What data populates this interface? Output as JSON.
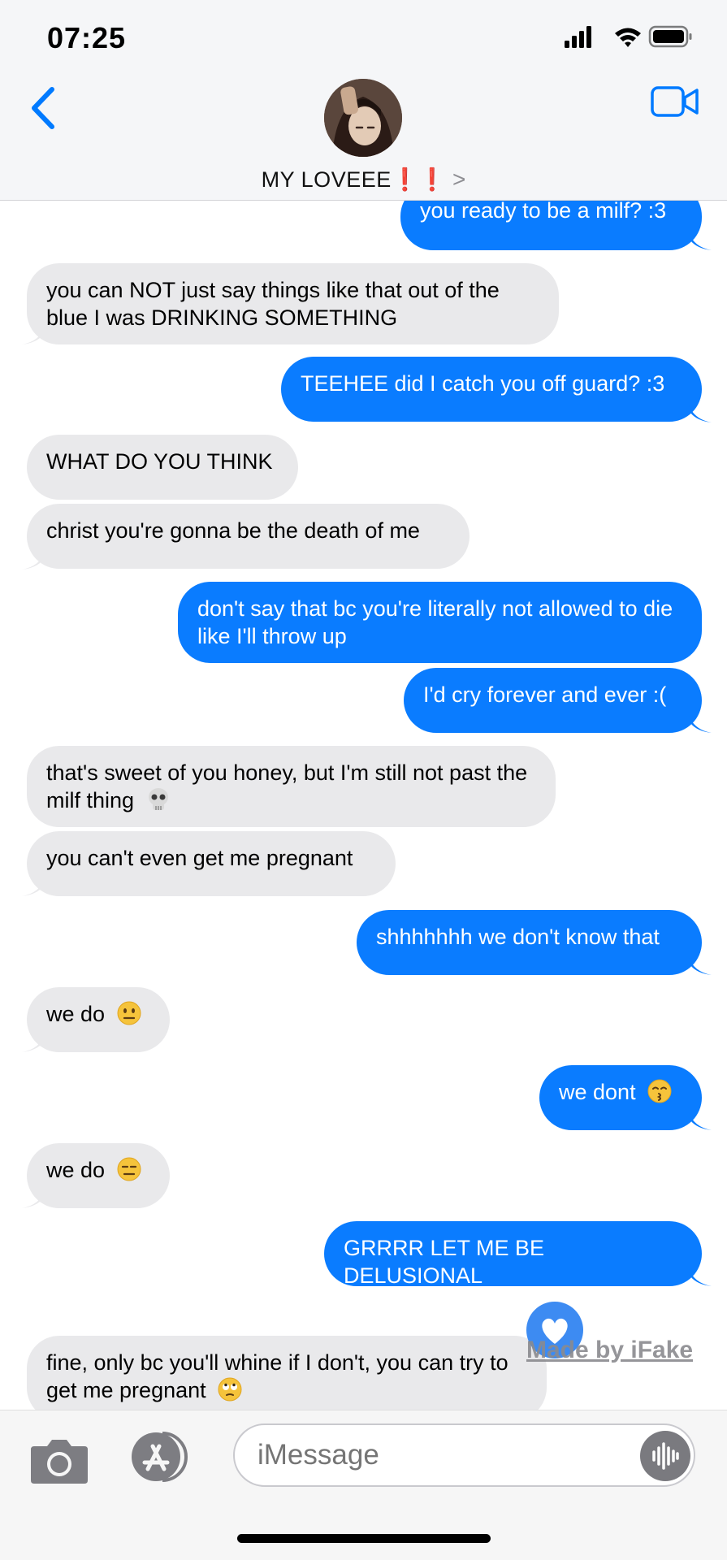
{
  "status_bar": {
    "time": "07:25"
  },
  "header": {
    "contact_name": "MY LOVEEE",
    "contact_emoji": "❗❗",
    "chevron": ">"
  },
  "messages": [
    {
      "side": "out",
      "text": "you ready to be a milf? :3"
    },
    {
      "side": "in",
      "text": "you can NOT just say things like that out of the blue I was DRINKING SOMETHING"
    },
    {
      "side": "out",
      "text": "TEEHEE did I catch you off guard? :3"
    },
    {
      "side": "in",
      "text": "WHAT DO YOU THINK"
    },
    {
      "side": "in",
      "text": "christ you're gonna be the death of me"
    },
    {
      "side": "out",
      "text": "don't say that bc you're literally not allowed to die like I'll throw up"
    },
    {
      "side": "out",
      "text": "I'd cry forever and ever :("
    },
    {
      "side": "in",
      "text": "that's sweet of you honey, but I'm still not past the milf thing",
      "emoji": "skull-emoji"
    },
    {
      "side": "in",
      "text": "you can't even get me pregnant"
    },
    {
      "side": "out",
      "text": "shhhhhhh we don't know that"
    },
    {
      "side": "in",
      "text": "we do",
      "emoji": "neutral-face-emoji"
    },
    {
      "side": "out",
      "text": "we dont",
      "emoji": "kissing-face-emoji"
    },
    {
      "side": "in",
      "text": "we do",
      "emoji": "expressionless-face-emoji"
    },
    {
      "side": "out",
      "text": "GRRRR LET ME BE DELUSIONAL"
    },
    {
      "side": "in",
      "text": "fine, only bc you'll whine if I don't, you can try to get me pregnant",
      "emoji": "eye-roll-emoji"
    }
  ],
  "watermark": {
    "text": "Made by iFake"
  },
  "input_bar": {
    "placeholder": "iMessage"
  },
  "colors": {
    "outgoing": "#0a7cff",
    "incoming": "#e9e9eb",
    "accent": "#007aff"
  }
}
